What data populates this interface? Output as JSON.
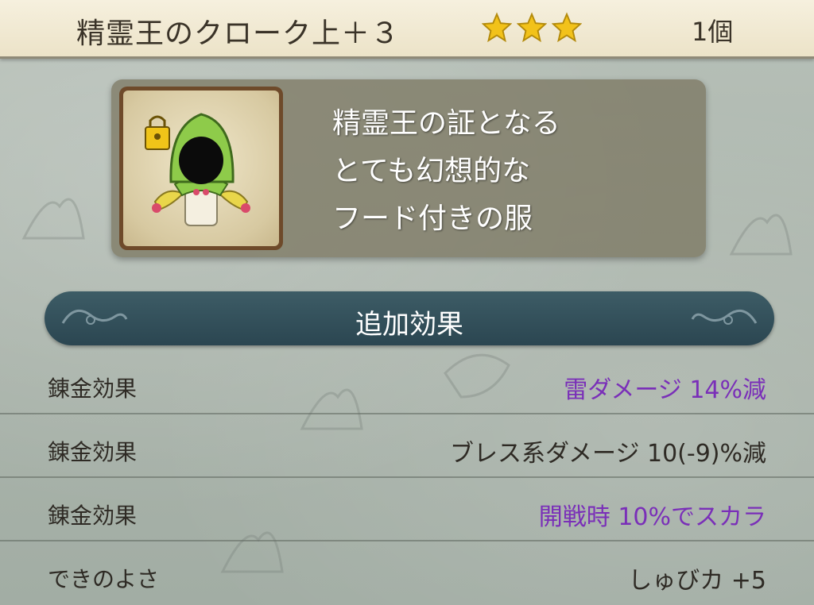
{
  "item": {
    "name": "精霊王のクローク上＋３",
    "quantity": "1個",
    "stars": 3,
    "icon": "green-hooded-cloak-icon",
    "locked": true
  },
  "description": {
    "lines": [
      "精霊王の証となる",
      "とても幻想的な",
      "フード付きの服"
    ]
  },
  "section": {
    "title": "追加効果"
  },
  "rows": [
    {
      "label": "錬金効果",
      "value": "雷ダメージ  14%減",
      "highlight": true
    },
    {
      "label": "錬金効果",
      "value": "ブレス系ダメージ  10(-9)%減",
      "highlight": false
    },
    {
      "label": "錬金効果",
      "value": "開戦時  10%でスカラ",
      "highlight": true
    },
    {
      "label": "できのよさ",
      "value": "しゅびカ  +5",
      "highlight": false
    }
  ],
  "colors": {
    "title_bg": "#efe6cc",
    "header_bg": "#2f4a55",
    "highlight_text": "#7a2fb8",
    "star": "#f2c21a"
  }
}
